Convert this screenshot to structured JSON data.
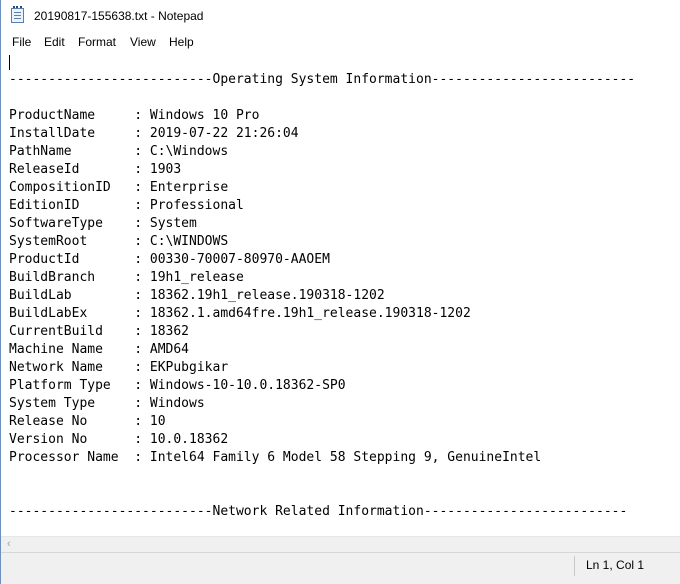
{
  "window": {
    "title": "20190817-155638.txt - Notepad"
  },
  "menu": [
    "File",
    "Edit",
    "Format",
    "View",
    "Help"
  ],
  "document": {
    "lines": [
      "",
      "--------------------------Operating System Information--------------------------",
      "",
      "ProductName     : Windows 10 Pro",
      "InstallDate     : 2019-07-22 21:26:04",
      "PathName        : C:\\Windows",
      "ReleaseId       : 1903",
      "CompositionID   : Enterprise",
      "EditionID       : Professional",
      "SoftwareType    : System",
      "SystemRoot      : C:\\WINDOWS",
      "ProductId       : 00330-70007-80970-AAOEM",
      "BuildBranch     : 19h1_release",
      "BuildLab        : 18362.19h1_release.190318-1202",
      "BuildLabEx      : 18362.1.amd64fre.19h1_release.190318-1202",
      "CurrentBuild    : 18362",
      "Machine Name    : AMD64",
      "Network Name    : EKPubgikar",
      "Platform Type   : Windows-10-10.0.18362-SP0",
      "System Type     : Windows",
      "Release No      : 10",
      "Version No      : 10.0.18362",
      "Processor Name  : Intel64 Family 6 Model 58 Stepping 9, GenuineIntel",
      "",
      "",
      "--------------------------Network Related Information--------------------------"
    ]
  },
  "scrollbar": {
    "left_arrow": "‹"
  },
  "status": {
    "position": "Ln 1, Col 1"
  }
}
